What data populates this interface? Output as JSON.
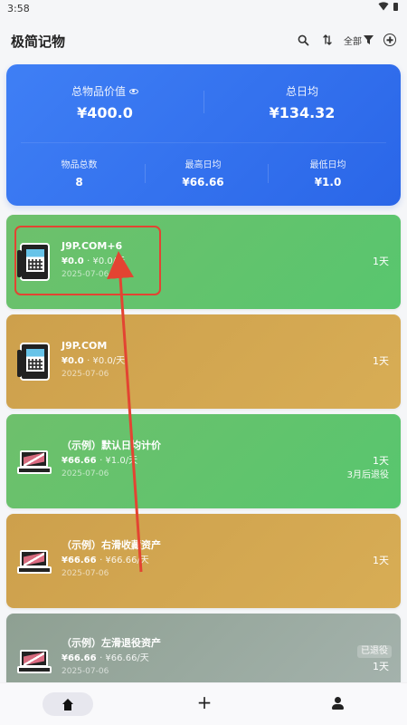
{
  "status_bar": {
    "time": "3:58",
    "icons": [
      "wifi-icon",
      "battery-icon"
    ]
  },
  "app_bar": {
    "title": "极简记物",
    "filter_label": "全部",
    "icons": [
      "search-icon",
      "sort-icon",
      "filter-icon",
      "add-circle-icon"
    ]
  },
  "summary": {
    "total_value_label": "总物品价值",
    "total_value": "¥400.0",
    "daily_total_label": "总日均",
    "daily_total": "¥134.32",
    "item_count_label": "物品总数",
    "item_count": "8",
    "max_daily_label": "最高日均",
    "max_daily": "¥66.66",
    "min_daily_label": "最低日均",
    "min_daily": "¥1.0",
    "colors": {
      "start": "#3f7ff5",
      "end": "#2a66e8"
    }
  },
  "items": [
    {
      "title": "J9P.COM+6",
      "price": "¥0.0",
      "daily": "· ¥0.0/天",
      "date": "2025-07-06",
      "days": "1天",
      "subtext": "",
      "icon": "phone-icon",
      "color": "#5ec56b"
    },
    {
      "title": "J9P.COM",
      "price": "¥0.0",
      "daily": "· ¥0.0/天",
      "date": "2025-07-06",
      "days": "1天",
      "subtext": "",
      "icon": "phone-icon",
      "color": "#d1a24f"
    },
    {
      "title": "（示例）默认日均计价",
      "price": "¥66.66",
      "daily": "· ¥1.0/天",
      "date": "2025-07-06",
      "days": "1天",
      "subtext": "3月后退役",
      "icon": "laptop-icon",
      "color": "#5ec56b"
    },
    {
      "title": "（示例）右滑收藏资产",
      "price": "¥66.66",
      "daily": "· ¥66.66/天",
      "date": "2025-07-06",
      "days": "1天",
      "subtext": "",
      "icon": "laptop-icon",
      "color": "#d1a24f"
    },
    {
      "title": "（示例）左滑退役资产",
      "price": "¥66.66",
      "daily": "· ¥66.66/天",
      "date": "2025-07-06",
      "days": "1天",
      "subtext": "已退役",
      "icon": "laptop-icon",
      "color": "#91a299"
    }
  ],
  "bottom_nav": {
    "items": [
      "home-icon",
      "add-icon",
      "user-icon"
    ],
    "add_label": "+"
  },
  "annotation": {
    "highlight_color": "#e34432"
  }
}
